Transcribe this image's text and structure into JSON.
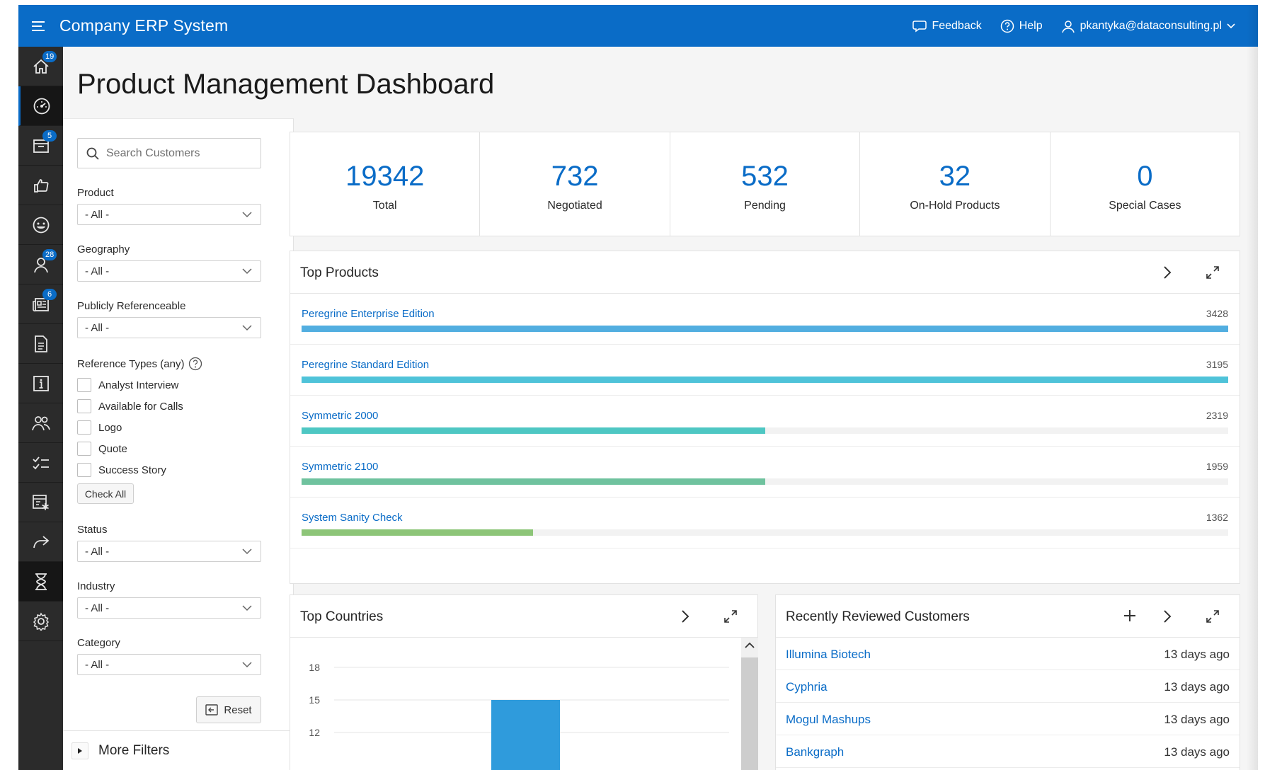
{
  "header": {
    "app_title": "Company ERP System",
    "feedback": "Feedback",
    "help": "Help",
    "user": "pkantyka@dataconsulting.pl"
  },
  "nav": {
    "items": [
      {
        "icon": "home-icon",
        "badge": "19"
      },
      {
        "icon": "dashboard-gauge-icon",
        "badge": ""
      },
      {
        "icon": "archive-box-icon",
        "badge": "5"
      },
      {
        "icon": "thumbs-up-icon",
        "badge": ""
      },
      {
        "icon": "emoji-face-icon",
        "badge": ""
      },
      {
        "icon": "user-icon",
        "badge": "28"
      },
      {
        "icon": "newspaper-icon",
        "badge": "6"
      },
      {
        "icon": "document-icon",
        "badge": ""
      },
      {
        "icon": "info-icon",
        "badge": ""
      },
      {
        "icon": "users-group-icon",
        "badge": ""
      },
      {
        "icon": "checklist-icon",
        "badge": ""
      },
      {
        "icon": "form-star-icon",
        "badge": ""
      },
      {
        "icon": "share-arrow-icon",
        "badge": ""
      },
      {
        "icon": "hourglass-icon",
        "badge": ""
      },
      {
        "icon": "gear-icon",
        "badge": ""
      }
    ]
  },
  "page": {
    "title": "Product Management Dashboard"
  },
  "filters": {
    "search_placeholder": "Search Customers",
    "product_label": "Product",
    "product_value": "- All -",
    "geography_label": "Geography",
    "geography_value": "- All -",
    "referenceable_label": "Publicly Referenceable",
    "referenceable_value": "- All -",
    "reftypes_label": "Reference Types (any)",
    "reftypes": [
      "Analyst Interview",
      "Available for Calls",
      "Logo",
      "Quote",
      "Success Story"
    ],
    "check_all": "Check All",
    "status_label": "Status",
    "status_value": "- All -",
    "industry_label": "Industry",
    "industry_value": "- All -",
    "category_label": "Category",
    "category_value": "- All -",
    "reset": "Reset",
    "more_filters": "More Filters"
  },
  "stats": [
    {
      "value": "19342",
      "label": "Total"
    },
    {
      "value": "732",
      "label": "Negotiated"
    },
    {
      "value": "532",
      "label": "Pending"
    },
    {
      "value": "32",
      "label": "On-Hold Products"
    },
    {
      "value": "0",
      "label": "Special Cases"
    }
  ],
  "top_products": {
    "title": "Top Products",
    "items": [
      {
        "name": "Peregrine Enterprise Edition",
        "value": "3428",
        "fill": 1.0,
        "color": "#52aee0"
      },
      {
        "name": "Peregrine Standard Edition",
        "value": "3195",
        "fill": 1.0,
        "color": "#4fc3d9"
      },
      {
        "name": "Symmetric 2000",
        "value": "2319",
        "fill": 0.5,
        "color": "#4ec7c3"
      },
      {
        "name": "Symmetric 2100",
        "value": "1959",
        "fill": 0.5,
        "color": "#6fc29e"
      },
      {
        "name": "System Sanity Check",
        "value": "1362",
        "fill": 0.25,
        "color": "#8dc578"
      }
    ]
  },
  "top_countries": {
    "title": "Top Countries",
    "chart_data": {
      "type": "bar",
      "y_ticks": [
        "18",
        "15",
        "12"
      ],
      "ylim": [
        12,
        18
      ],
      "values": [
        15
      ],
      "color": "#2f9bdc"
    }
  },
  "recently_reviewed": {
    "title": "Recently Reviewed Customers",
    "items": [
      {
        "name": "Illumina Biotech",
        "time": "13 days ago"
      },
      {
        "name": "Cyphria",
        "time": "13 days ago"
      },
      {
        "name": "Mogul Mashups",
        "time": "13 days ago"
      },
      {
        "name": "Bankgraph",
        "time": "13 days ago"
      }
    ]
  }
}
